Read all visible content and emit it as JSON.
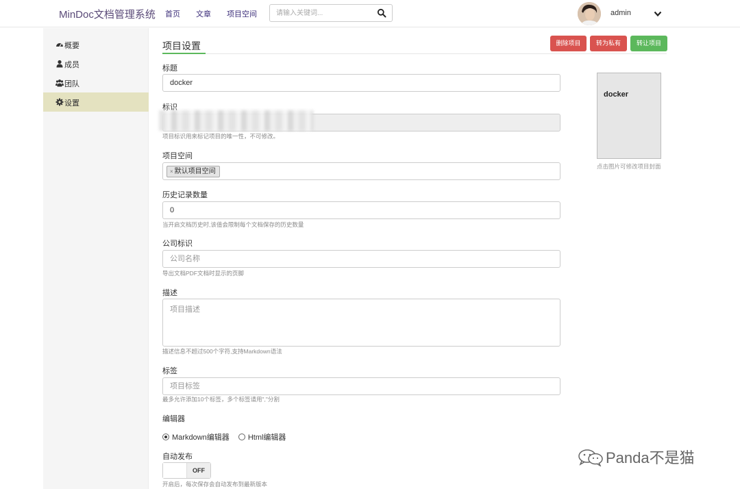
{
  "header": {
    "brand": "MinDoc文档管理系统",
    "nav": [
      "首页",
      "文章",
      "项目空间"
    ],
    "search_placeholder": "请输入关键词...",
    "username": "admin"
  },
  "sidebar": {
    "items": [
      {
        "label": "概要",
        "icon": "dashboard-icon"
      },
      {
        "label": "成员",
        "icon": "user-icon"
      },
      {
        "label": "团队",
        "icon": "users-icon"
      },
      {
        "label": "设置",
        "icon": "gear-icon",
        "active": true
      }
    ]
  },
  "main": {
    "title": "项目设置",
    "buttons": {
      "delete": "删除项目",
      "private": "转为私有",
      "transfer": "转让项目"
    },
    "fields": {
      "title": {
        "label": "标题",
        "value": "docker"
      },
      "identifier": {
        "label": "标识",
        "help": "项目标识用来标记项目的唯一性，不可修改。"
      },
      "space": {
        "label": "项目空间",
        "tag": "默认项目空间",
        "tag_remove": "×"
      },
      "history": {
        "label": "历史记录数量",
        "value": "0",
        "help": "当开启文档历史时,该值会限制每个文档保存的历史数量"
      },
      "company": {
        "label": "公司标识",
        "placeholder": "公司名称",
        "help": "导出文档PDF文档时显示的页脚"
      },
      "description": {
        "label": "描述",
        "placeholder": "项目描述",
        "help": "描述信息不超过500个字符,支持Markdown语法"
      },
      "tags": {
        "label": "标签",
        "placeholder": "项目标签",
        "help": "最多允许添加10个标签，多个标签请用\",\"分割"
      },
      "editor": {
        "label": "编辑器",
        "options": [
          "Markdown编辑器",
          "Html编辑器"
        ],
        "selected": "Markdown编辑器"
      },
      "auto_publish": {
        "label": "自动发布",
        "state": "OFF",
        "help": "开启后，每次保存会自动发布到最新版本"
      }
    }
  },
  "cover": {
    "title": "docker",
    "hint": "点击图片可修改项目封面"
  },
  "watermark": "Panda不是猫"
}
